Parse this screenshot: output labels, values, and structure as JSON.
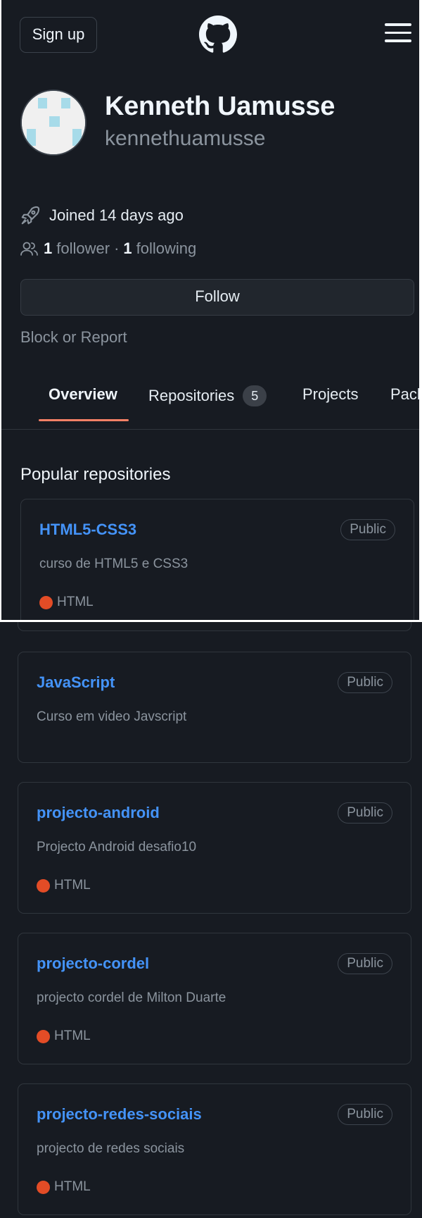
{
  "header": {
    "signup_label": "Sign up",
    "logo_icon": "github-mark-icon",
    "menu_icon": "hamburger-menu-icon"
  },
  "profile": {
    "avatar_icon": "identicon-avatar",
    "name": "Kenneth Uamusse",
    "username": "kennethuamusse",
    "joined_icon": "rocket-icon",
    "joined_text": "Joined 14 days ago",
    "people_icon": "people-icon",
    "followers_count": "1",
    "followers_label": "follower",
    "separator": "·",
    "following_count": "1",
    "following_label": "following",
    "follow_label": "Follow",
    "block_report_label": "Block or Report"
  },
  "tabs": [
    {
      "label": "Overview",
      "active": true
    },
    {
      "label": "Repositories",
      "count": "5"
    },
    {
      "label": "Projects"
    },
    {
      "label": "Pack"
    }
  ],
  "popular": {
    "title": "Popular repositories",
    "repos": [
      {
        "name": "HTML5-CSS3",
        "visibility": "Public",
        "description": "curso de HTML5 e CSS3",
        "language": "HTML"
      },
      {
        "name": "JavaScript",
        "visibility": "Public",
        "description": "Curso em video Javscript",
        "language": ""
      },
      {
        "name": "projecto-android",
        "visibility": "Public",
        "description": "Projecto Android desafio10",
        "language": "HTML"
      },
      {
        "name": "projecto-cordel",
        "visibility": "Public",
        "description": "projecto cordel de Milton Duarte",
        "language": "HTML"
      },
      {
        "name": "projecto-redes-sociais",
        "visibility": "Public",
        "description": "projecto de redes sociais",
        "language": "HTML"
      }
    ]
  },
  "colors": {
    "background": "#171b22",
    "link_blue": "#4493f8",
    "tab_underline": "#f78166",
    "html_language": "#e34c26",
    "muted_text": "#8b949e"
  }
}
